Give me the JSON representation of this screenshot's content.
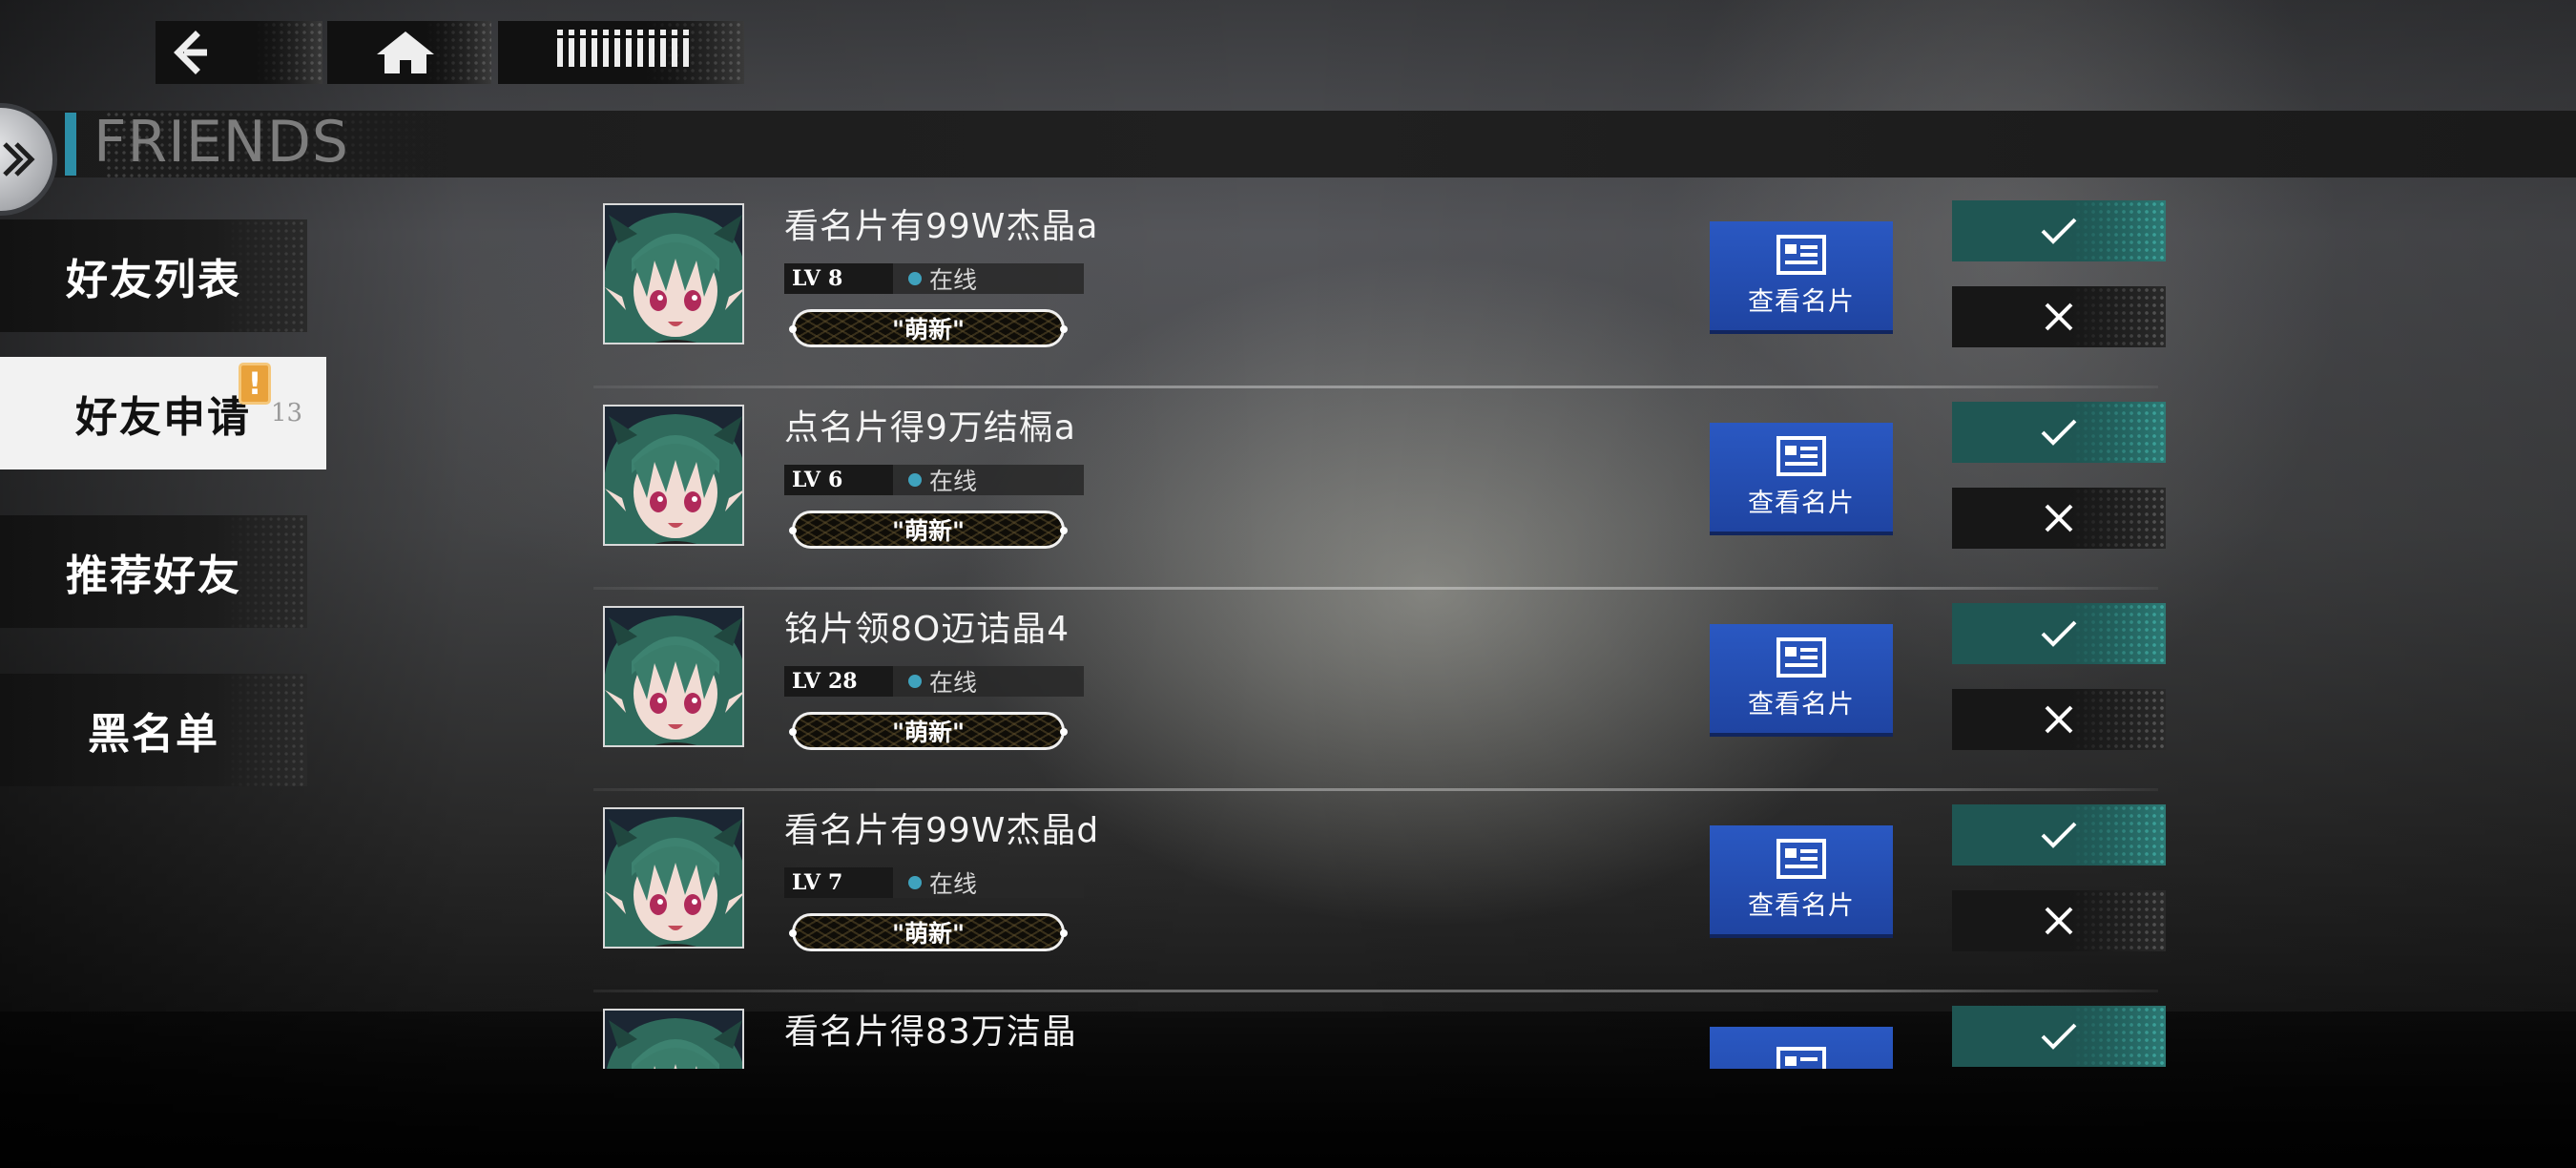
{
  "nav": {
    "back_icon": "back-arrow-icon",
    "home_icon": "home-icon",
    "more_icon": "menu-bars-icon"
  },
  "header": {
    "title": "FRIENDS",
    "accent_color": "#2c8ea7"
  },
  "sidebar": {
    "tabs": [
      {
        "label": "好友列表"
      },
      {
        "label": "好友申请",
        "alert": "!",
        "count": "13"
      },
      {
        "label": "推荐好友"
      },
      {
        "label": "黑名单"
      }
    ],
    "active_index": 1
  },
  "requests": [
    {
      "name": "看名片有99W杰晶a",
      "level_prefix": "LV",
      "level": "8",
      "status": "在线",
      "title": "\"萌新\"",
      "view_card_label": "查看名片"
    },
    {
      "name": "点名片得9万结槅a",
      "level_prefix": "LV",
      "level": "6",
      "status": "在线",
      "title": "\"萌新\"",
      "view_card_label": "查看名片"
    },
    {
      "name": "铭片领8O迈诘晶4",
      "level_prefix": "LV",
      "level": "28",
      "status": "在线",
      "title": "\"萌新\"",
      "view_card_label": "查看名片"
    },
    {
      "name": "看名片有99W杰晶d",
      "level_prefix": "LV",
      "level": "7",
      "status": "在线",
      "title": "\"萌新\"",
      "view_card_label": "查看名片"
    },
    {
      "name": "看名片得83万洁晶",
      "level_prefix": "LV",
      "level": "",
      "status": "",
      "title": "",
      "view_card_label": ""
    }
  ],
  "colors": {
    "accept": "#1f5653",
    "view_card": "#2a58c2",
    "online": "#3fa2bd"
  }
}
